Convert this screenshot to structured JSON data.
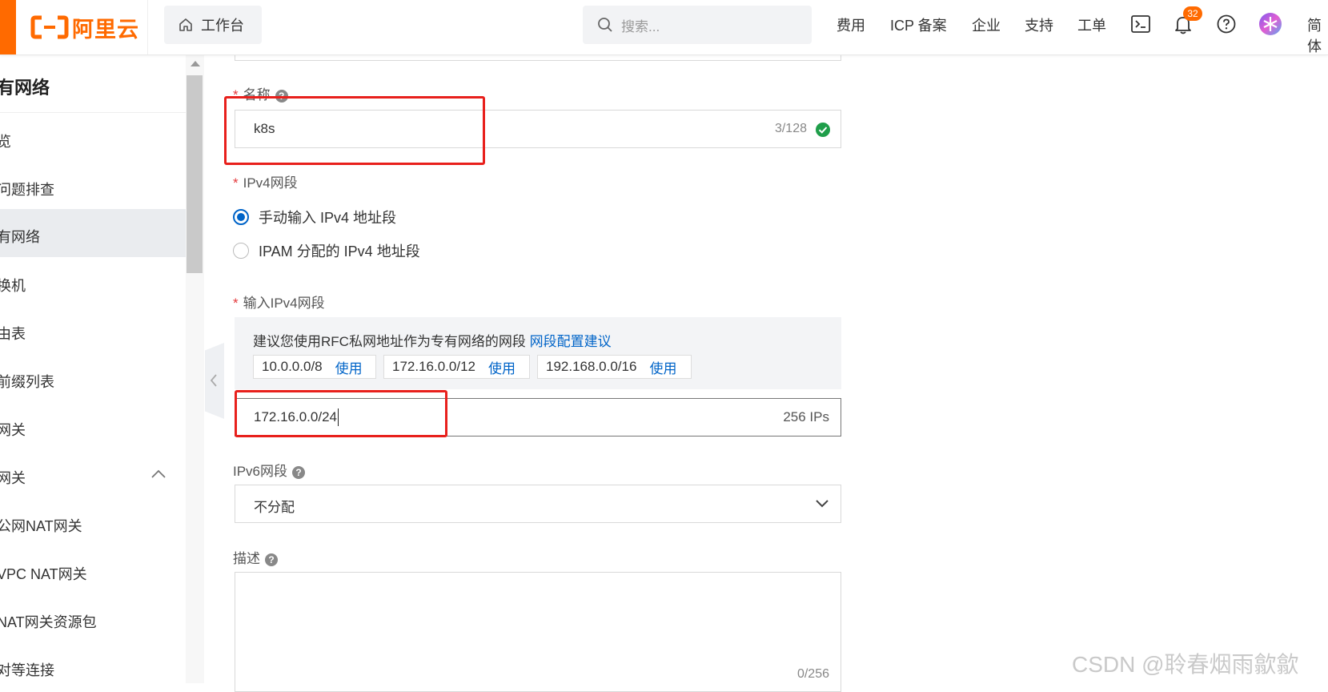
{
  "topbar": {
    "logo_text": "阿里云",
    "workbench_label": "工作台",
    "search_placeholder": "搜索...",
    "nav": [
      "费用",
      "ICP 备案",
      "企业",
      "支持",
      "工单"
    ],
    "notification_count": "32",
    "lang_label": "简体"
  },
  "sidebar": {
    "title": "有网络",
    "items": [
      "览",
      "问题排查",
      "有网络",
      "换机",
      "由表",
      "前缀列表",
      "网关",
      "网关",
      "公网NAT网关",
      "VPC NAT网关",
      "NAT网关资源包",
      "对等连接"
    ],
    "active_index": 2
  },
  "form": {
    "name_label": "名称",
    "name_value": "k8s",
    "name_counter": "3/128",
    "ipv4_label": "IPv4网段",
    "radio_manual": "手动输入 IPv4 地址段",
    "radio_ipam": "IPAM 分配的 IPv4 地址段",
    "input_ipv4_label": "输入IPv4网段",
    "hint_text": "建议您使用RFC私网地址作为专有网络的网段",
    "hint_link": "网段配置建议",
    "cidrs": [
      {
        "cidr": "10.0.0.0/8",
        "use": "使用"
      },
      {
        "cidr": "172.16.0.0/12",
        "use": "使用"
      },
      {
        "cidr": "192.168.0.0/16",
        "use": "使用"
      }
    ],
    "ipv4_value": "172.16.0.0/24",
    "ipv4_count": "256 IPs",
    "ipv6_label": "IPv6网段",
    "ipv6_value": "不分配",
    "desc_label": "描述",
    "desc_counter": "0/256"
  },
  "watermark": "CSDN @聆春烟雨歙歙",
  "colors": {
    "brand": "#ff6a00",
    "link": "#0064c8",
    "annotation": "#e8201c",
    "success": "#1f9e4a"
  }
}
